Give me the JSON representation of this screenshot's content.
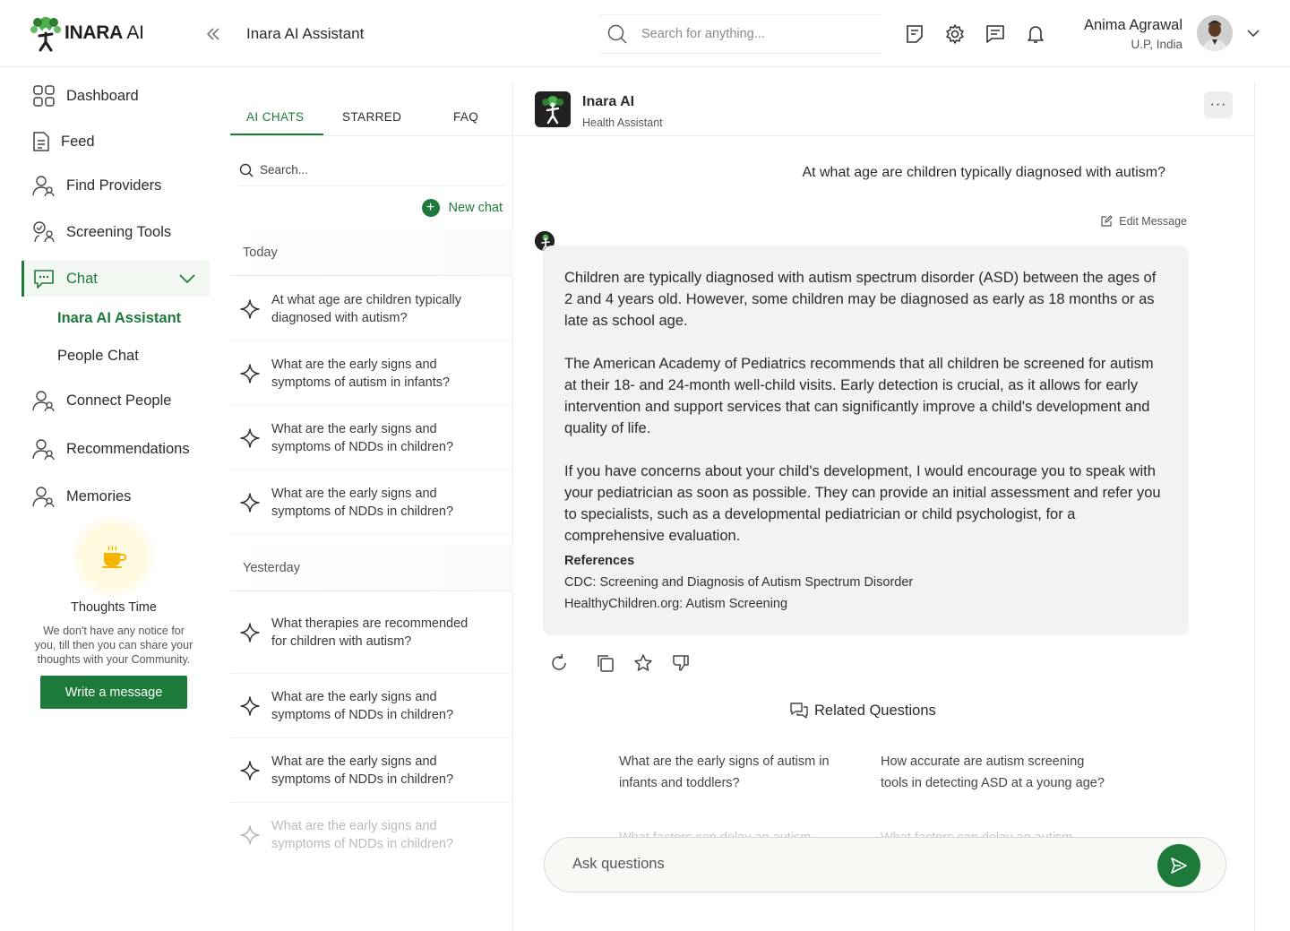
{
  "brand": {
    "name_bold": "INARA",
    "name_light": " AI"
  },
  "header": {
    "title": "Inara AI Assistant",
    "search_placeholder": "Search for anything...",
    "user_name": "Anima Agrawal",
    "user_location": "U.P, India"
  },
  "sidebar": {
    "items": [
      {
        "label": "Dashboard",
        "icon": "grid-icon"
      },
      {
        "label": "Feed",
        "icon": "document-icon"
      },
      {
        "label": "Find Providers",
        "icon": "people-icon"
      },
      {
        "label": "Screening Tools",
        "icon": "screening-icon"
      },
      {
        "label": "Chat",
        "icon": "chat-bubble-icon"
      },
      {
        "label": "Connect People",
        "icon": "people-icon"
      },
      {
        "label": "Recommendations",
        "icon": "people-icon"
      },
      {
        "label": "Memories",
        "icon": "people-icon"
      }
    ],
    "chat_sub": [
      "Inara AI Assistant",
      "People Chat"
    ],
    "thoughts": {
      "title": "Thoughts Time",
      "text": "We don't have any notice for you, till then you can share your thoughts with your Community.",
      "button": "Write a message"
    }
  },
  "chatlist": {
    "tabs": [
      "AI CHATS",
      "STARRED",
      "FAQ"
    ],
    "search_placeholder": "Search...",
    "new_chat": "New chat",
    "groups": [
      {
        "label": "Today",
        "items": [
          "At what age are children typically diagnosed with autism?",
          "What are the early signs and symptoms of autism in infants?",
          "What are the early signs and symptoms of NDDs in children?",
          "What are the early signs and symptoms of NDDs in children?"
        ]
      },
      {
        "label": "Yesterday",
        "items": [
          "What therapies are recommended for children with autism?",
          "What are the early signs and symptoms of NDDs in children?",
          "What are the early signs and symptoms of NDDs in children?",
          "What are the early signs and symptoms of NDDs in children?"
        ]
      }
    ]
  },
  "conversation": {
    "bot_name": "Inara AI",
    "bot_role": "Health Assistant",
    "more": "···",
    "user_message": "At what age are children typically diagnosed with autism?",
    "edit_label": "Edit Message",
    "answer": [
      "Children are typically diagnosed with autism spectrum disorder (ASD) between the ages of 2 and 4 years old. However, some children may be diagnosed as early as 18 months or as late as school age.",
      "The American Academy of Pediatrics recommends that all children be screened for autism at their 18- and 24-month well-child visits. Early detection is crucial, as it allows for early intervention and support services that can significantly improve a child's development and quality of life.",
      "If you have concerns about your child's development, I would encourage you to speak with your pediatrician as soon as possible. They can provide an initial assessment and refer you to specialists, such as a developmental pediatrician or child psychologist, for a comprehensive evaluation."
    ],
    "references_title": "References",
    "references": [
      "CDC: Screening and Diagnosis of Autism Spectrum Disorder",
      "HealthyChildren.org: Autism Screening"
    ],
    "related_title": "Related Questions",
    "related": [
      "What are the early signs of autism in infants and toddlers?",
      "How accurate are autism screening tools in detecting ASD at a young age?",
      "What factors can delay an autism",
      "What factors can delay an autism"
    ],
    "ask_placeholder": "Ask questions"
  },
  "colors": {
    "accent": "#1e7a3a",
    "answer_bg": "#f2f2f3",
    "active_nav_bg": "#f2f7f1"
  }
}
